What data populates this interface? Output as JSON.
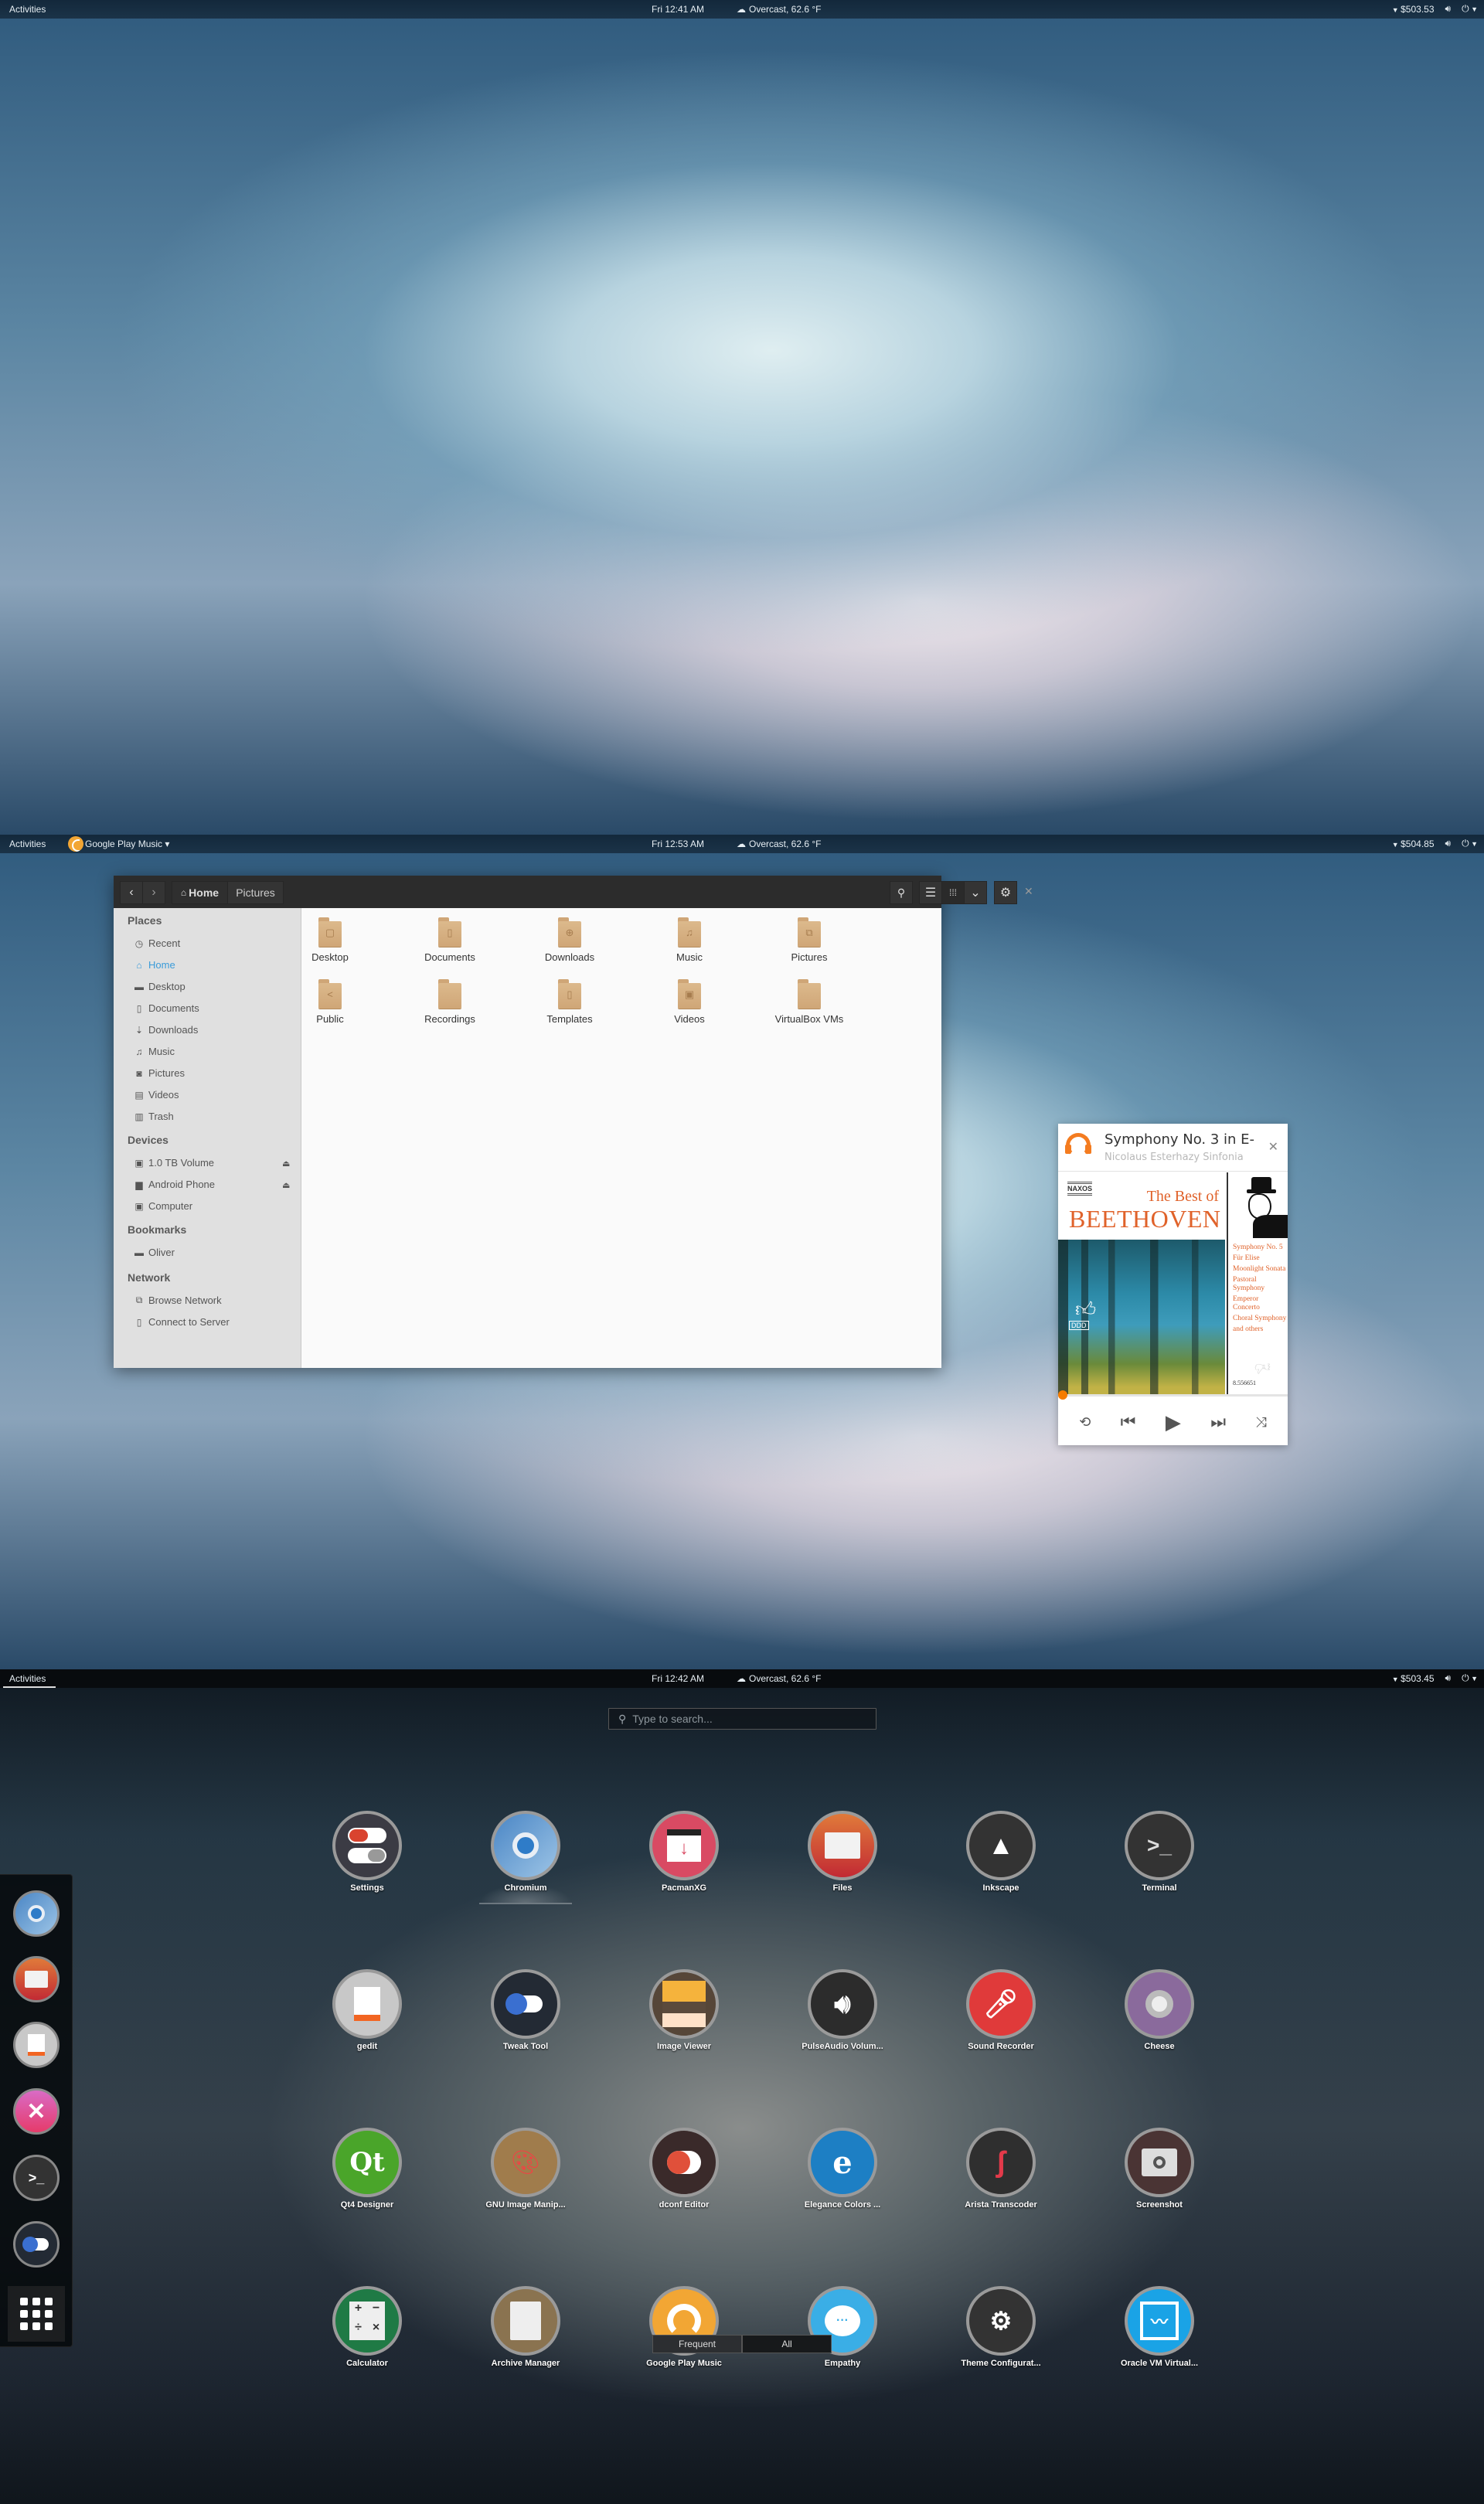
{
  "screens": [
    {
      "topbar": {
        "activities": "Activities",
        "clock": "Fri 12:41 AM",
        "weather": "Overcast, 62.6 °F",
        "stock": "$503.53"
      }
    },
    {
      "topbar": {
        "activities": "Activities",
        "app_menu": "Google Play Music ▾",
        "clock": "Fri 12:53 AM",
        "weather": "Overcast, 62.6 °F",
        "stock": "$504.85"
      },
      "file_manager": {
        "path": [
          {
            "label": "Home",
            "icon": "home-icon"
          },
          {
            "label": "Pictures"
          }
        ],
        "toolbar_icons": [
          "search-icon",
          "list-view-icon",
          "grid-view-icon",
          "chevron-down-icon",
          "gear-icon",
          "close-icon"
        ],
        "sidebar": {
          "places_heading": "Places",
          "places": [
            {
              "label": "Recent",
              "icon": "clock-icon"
            },
            {
              "label": "Home",
              "icon": "home-icon",
              "selected": true
            },
            {
              "label": "Desktop",
              "icon": "folder-icon"
            },
            {
              "label": "Documents",
              "icon": "document-icon"
            },
            {
              "label": "Downloads",
              "icon": "download-icon"
            },
            {
              "label": "Music",
              "icon": "music-icon"
            },
            {
              "label": "Pictures",
              "icon": "camera-icon"
            },
            {
              "label": "Videos",
              "icon": "film-icon"
            },
            {
              "label": "Trash",
              "icon": "trash-icon"
            }
          ],
          "devices_heading": "Devices",
          "devices": [
            {
              "label": "1.0 TB Volume",
              "icon": "drive-icon",
              "eject": true
            },
            {
              "label": "Android Phone",
              "icon": "phone-icon",
              "eject": true
            },
            {
              "label": "Computer",
              "icon": "drive-icon",
              "eject": false
            }
          ],
          "bookmarks_heading": "Bookmarks",
          "bookmarks": [
            {
              "label": "Oliver",
              "icon": "folder-icon"
            }
          ],
          "network_heading": "Network",
          "network": [
            {
              "label": "Browse Network",
              "icon": "network-icon"
            },
            {
              "label": "Connect to Server",
              "icon": "server-icon"
            }
          ]
        },
        "folders": [
          {
            "label": "Desktop",
            "glyph": "▢"
          },
          {
            "label": "Documents",
            "glyph": "▯"
          },
          {
            "label": "Downloads",
            "glyph": "⊕"
          },
          {
            "label": "Music",
            "glyph": "♫"
          },
          {
            "label": "Pictures",
            "glyph": "⧉"
          },
          {
            "label": "Public",
            "glyph": "<"
          },
          {
            "label": "Recordings",
            "glyph": ""
          },
          {
            "label": "Templates",
            "glyph": "▯"
          },
          {
            "label": "Videos",
            "glyph": "▣"
          },
          {
            "label": "VirtualBox VMs",
            "glyph": ""
          }
        ]
      },
      "music_widget": {
        "title": "Symphony No. 3 in E-",
        "artist": "Nicolaus Esterhazy Sinfonia",
        "progress_percent": 0,
        "cover": {
          "label": "NAXOS",
          "line1": "The Best of",
          "line2": "BEETHOVEN",
          "tracks": [
            "Symphony No. 5",
            "Für Elise",
            "Moonlight Sonata",
            "Pastoral Symphony",
            "Emperor Concerto",
            "Choral Symphony",
            "and others"
          ],
          "catalog": "8.556651",
          "badge": "DDD"
        },
        "controls": [
          "repeat-icon",
          "previous-icon",
          "play-icon",
          "next-icon",
          "shuffle-icon"
        ]
      }
    },
    {
      "topbar": {
        "activities": "Activities",
        "clock": "Fri 12:42 AM",
        "weather": "Overcast, 62.6 °F",
        "stock": "$503.45"
      },
      "search": {
        "placeholder": "Type to search..."
      },
      "dash": [
        "Chromium",
        "Files",
        "gedit",
        "Unknown (pink X)",
        "Terminal",
        "Tweak Tool",
        "Show Applications"
      ],
      "apps": [
        [
          "Settings",
          "Chromium",
          "PacmanXG",
          "Files",
          "Inkscape",
          "Terminal"
        ],
        [
          "gedit",
          "Tweak Tool",
          "Image Viewer",
          "PulseAudio Volum...",
          "Sound Recorder",
          "Cheese"
        ],
        [
          "Qt4 Designer",
          "GNU Image Manip...",
          "dconf Editor",
          "Elegance Colors ...",
          "Arista Transcoder",
          "Screenshot"
        ],
        [
          "Calculator",
          "Archive Manager",
          "Google Play Music",
          "Empathy",
          "Theme Configurat...",
          "Oracle VM Virtual..."
        ]
      ],
      "view_toggle": {
        "frequent": "Frequent",
        "all": "All"
      }
    }
  ]
}
